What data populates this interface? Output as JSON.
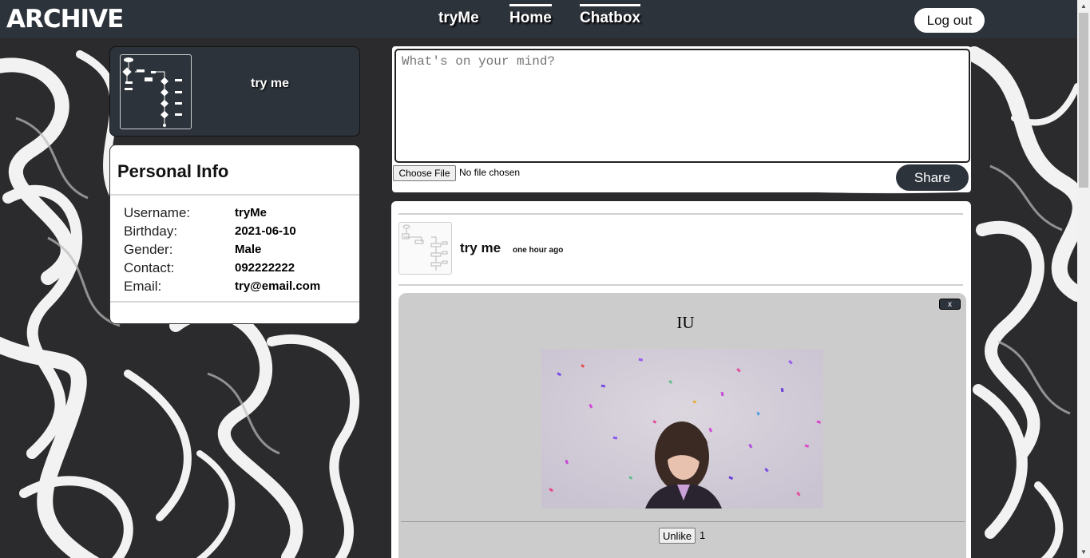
{
  "app": {
    "logo": "ARCHIVE"
  },
  "nav": {
    "items": [
      {
        "label": "tryMe",
        "active": false
      },
      {
        "label": "Home",
        "active": true
      },
      {
        "label": "Chatbox",
        "active": true
      }
    ],
    "logout_label": "Log out"
  },
  "profile": {
    "display_name": "try me"
  },
  "personal_info": {
    "title": "Personal Info",
    "rows": [
      {
        "label": "Username:",
        "value": "tryMe"
      },
      {
        "label": "Birthday:",
        "value": "2021-06-10"
      },
      {
        "label": "Gender:",
        "value": "Male"
      },
      {
        "label": "Contact:",
        "value": "092222222"
      },
      {
        "label": "Email:",
        "value": "try@email.com"
      }
    ]
  },
  "composer": {
    "placeholder": "What's on your mind?",
    "choose_file_label": "Choose File",
    "file_status": "No file chosen",
    "share_label": "Share"
  },
  "post": {
    "author": "try me",
    "time": "one hour ago",
    "close_label": "x",
    "caption": "IU",
    "unlike_label": "Unlike",
    "like_count": "1"
  },
  "colors": {
    "nav_bg": "#2d333b",
    "post_bg": "#cccccc"
  }
}
